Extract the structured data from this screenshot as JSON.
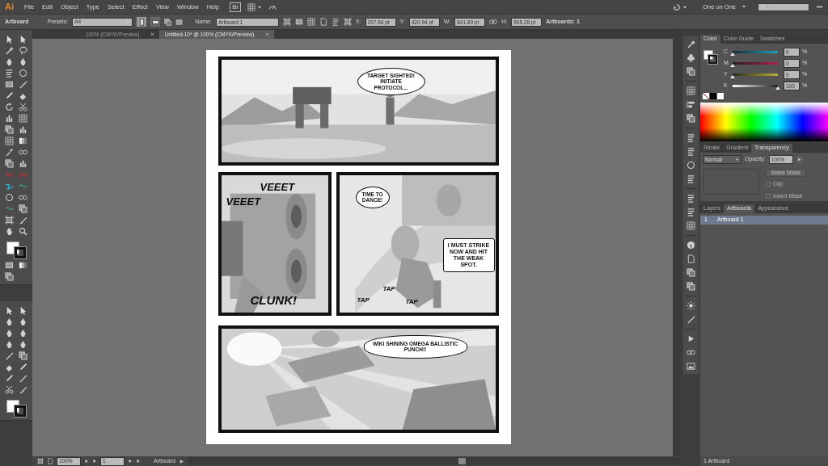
{
  "app": {
    "logo": "Ai",
    "menus": [
      "File",
      "Edit",
      "Object",
      "Type",
      "Select",
      "Effect",
      "View",
      "Window",
      "Help"
    ],
    "bridge": "Br",
    "workspace": "One on One"
  },
  "control_bar": {
    "tool": "Artboard",
    "presets_label": "Presets:",
    "preset": "A4",
    "name_label": "Name:",
    "name": "Artboard 1",
    "fields": [
      {
        "label": "X:",
        "value": "297.64 pt"
      },
      {
        "label": "Y:",
        "value": "420.94 pt"
      },
      {
        "label": "W:",
        "value": "841.89 pt"
      },
      {
        "label": "H:",
        "value": "595.28 pt"
      }
    ],
    "artboards": "Artboards: 1"
  },
  "tabs": [
    {
      "label": "100% (CMYK/Preview)",
      "selected": false
    },
    {
      "label": "Untitled-10* @ 100% (CMYK/Preview)",
      "selected": true
    }
  ],
  "artboard": {
    "panels": [
      {
        "texts": [
          {
            "kind": "speech",
            "text": "TARGET SIGHTED! INITIATE PROTOCOL..."
          }
        ]
      },
      {
        "texts": [
          {
            "kind": "sfx",
            "text": "VEEET"
          },
          {
            "kind": "sfx",
            "text": "VEEET"
          },
          {
            "kind": "sfx",
            "text": "CLUNK!"
          }
        ]
      },
      {
        "texts": [
          {
            "kind": "speech",
            "text": "TIME TO DANCE!"
          },
          {
            "kind": "caption",
            "text": "I MUST STRIKE NOW AND HIT THE WEAK SPOT."
          },
          {
            "kind": "sfx",
            "text": "TAP"
          },
          {
            "kind": "sfx",
            "text": "TAP"
          },
          {
            "kind": "sfx",
            "text": "TAP"
          }
        ]
      },
      {
        "texts": [
          {
            "kind": "burst",
            "text": "WIKI SHINING OMEGA BALLISTIC PUNCH!!"
          }
        ]
      }
    ]
  },
  "color_panel": {
    "tabs": [
      {
        "label": "Color",
        "selected": true
      },
      {
        "label": "Color Guide",
        "selected": false
      },
      {
        "label": "Swatches",
        "selected": false
      }
    ],
    "channels": [
      {
        "label": "C",
        "level": 0,
        "value": "0",
        "unit": "%"
      },
      {
        "label": "M",
        "level": 0,
        "value": "0",
        "unit": "%"
      },
      {
        "label": "Y",
        "level": 0,
        "value": "0",
        "unit": "%"
      },
      {
        "label": "K",
        "level": 1,
        "value": "100",
        "unit": "%"
      }
    ]
  },
  "transparency_panel": {
    "tabs": [
      {
        "label": "Stroke",
        "selected": false
      },
      {
        "label": "Gradient",
        "selected": false
      },
      {
        "label": "Transparency",
        "selected": true
      }
    ],
    "blend_mode": "Normal",
    "opacity_label": "Opacity:",
    "opacity": "100%",
    "make_mask": {
      "label": "Make Mask",
      "disabled": true
    },
    "options": [
      {
        "label": "Clip",
        "checked": false,
        "disabled": true
      },
      {
        "label": "Invert Mask",
        "checked": false,
        "disabled": true
      }
    ]
  },
  "artboards_panel": {
    "tabs": [
      {
        "label": "Layers",
        "selected": false
      },
      {
        "label": "Artboards",
        "selected": true
      },
      {
        "label": "Appearance",
        "selected": false
      }
    ],
    "rows": [
      {
        "number": "1",
        "name": "Artboard 1",
        "selected": true
      }
    ],
    "footer": "1 Artboard"
  },
  "status_bar": {
    "zoom": "100%",
    "page": "1",
    "tool": "Artboard"
  }
}
